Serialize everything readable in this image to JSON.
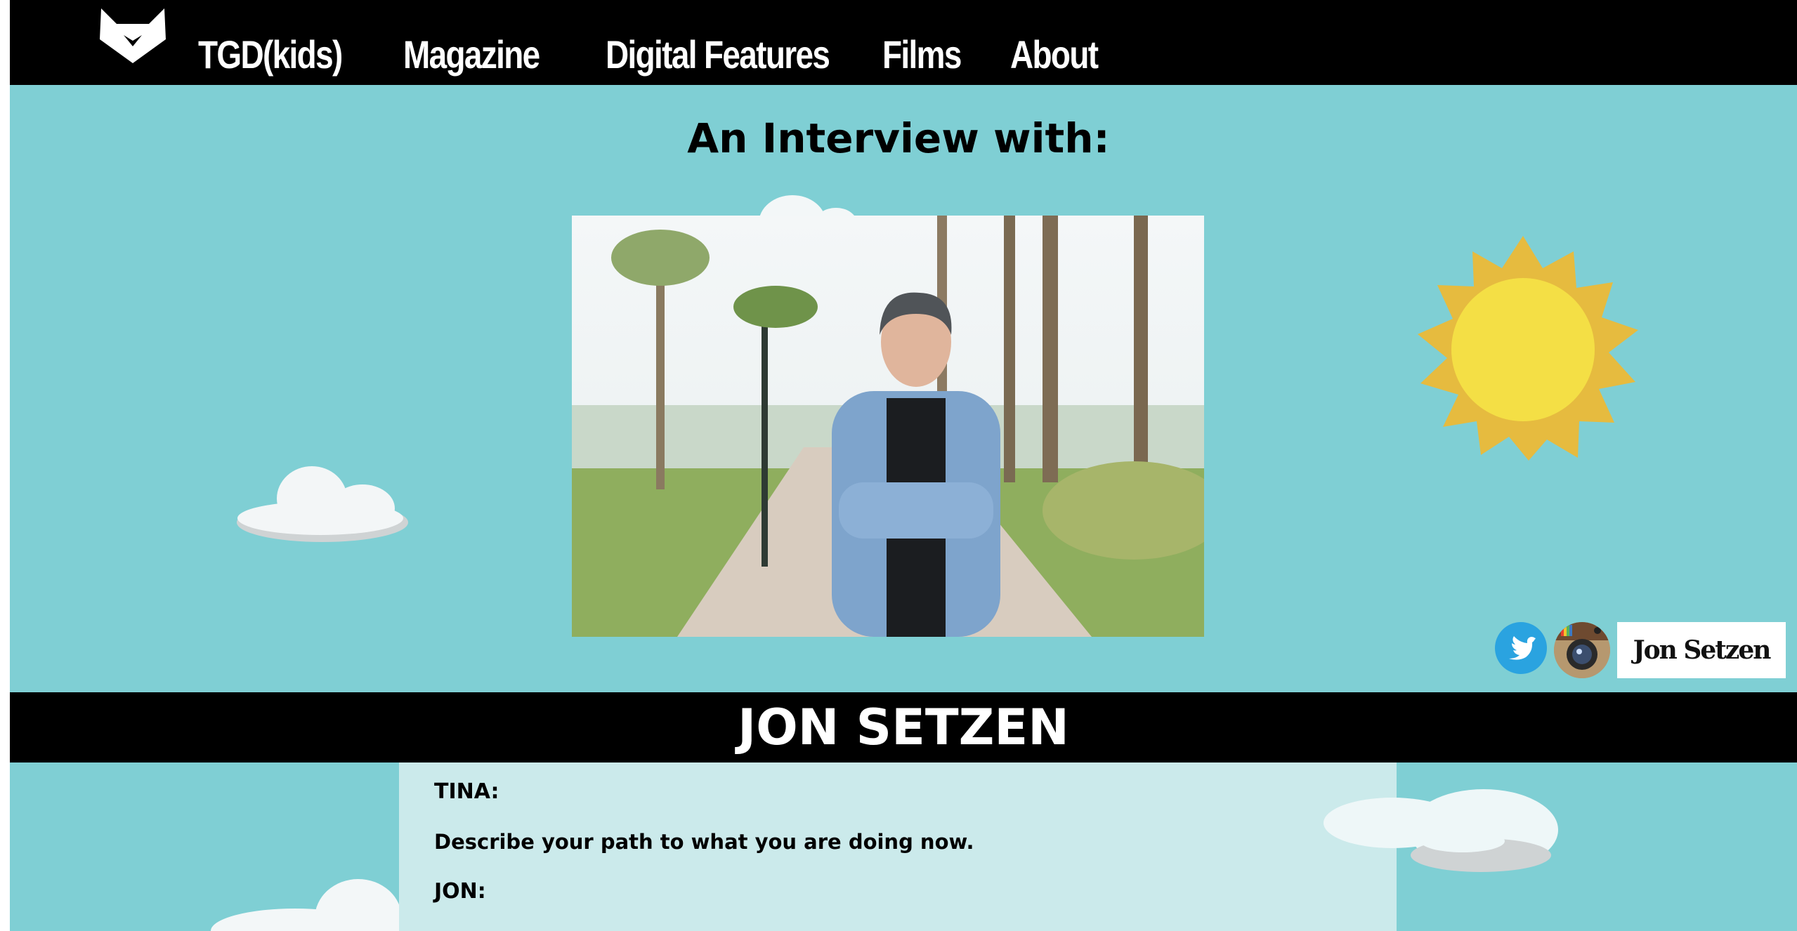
{
  "nav": {
    "links": [
      {
        "label": "TGD(kids)"
      },
      {
        "label": "Magazine"
      },
      {
        "label": "Digital Features"
      },
      {
        "label": "Films"
      },
      {
        "label": "About"
      }
    ]
  },
  "headline": "An Interview with:",
  "name_tag": "Jon Setzen",
  "name_banner": "JON SETZEN",
  "interview": {
    "speaker1": "TINA:",
    "question1": "Describe your path to what you are doing now.",
    "speaker2": "JON:"
  },
  "icons": {
    "logo": "fox-logo-icon",
    "twitter": "twitter-icon",
    "instagram": "instagram-icon"
  },
  "colors": {
    "background": "#7fcfd4",
    "nav": "#000000",
    "twitter": "#2aa3e0",
    "sun": "#f4df45",
    "sun_rays": "#e6bb3f",
    "content_panel": "#cbeaeb"
  }
}
